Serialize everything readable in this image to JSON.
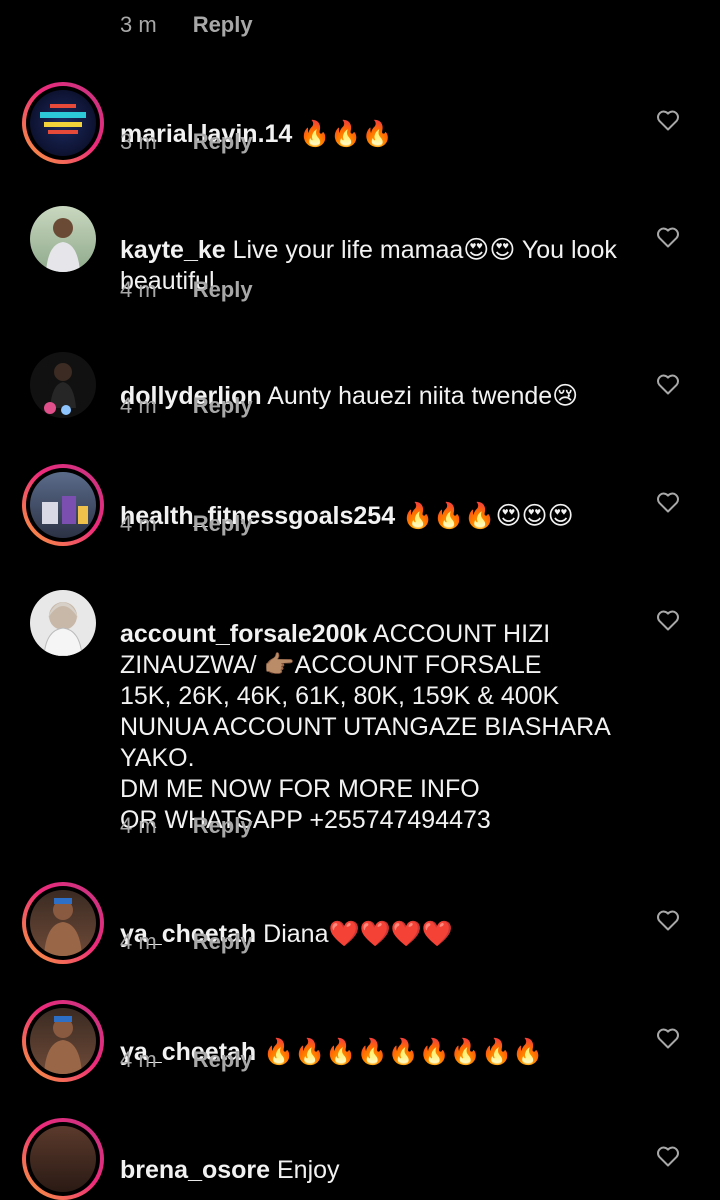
{
  "top": {
    "time": "3 m",
    "reply": "Reply"
  },
  "comments": [
    {
      "user": "marial.lavin.14",
      "text": " 🔥🔥🔥",
      "time": "3 m",
      "reply": "Reply"
    },
    {
      "user": "kayte_ke",
      "text": " Live your life mamaa😍😍 You look beautiful",
      "time": "4 m",
      "reply": "Reply"
    },
    {
      "user": "dollyderlion",
      "text": " Aunty hauezi niita twende😢",
      "time": "4 m",
      "reply": "Reply"
    },
    {
      "user": "health_fitnessgoals254",
      "text": " 🔥🔥🔥😍😍😍",
      "time": "4 m",
      "reply": "Reply"
    },
    {
      "user": "account_forsale200k",
      "text": " ACCOUNT HIZI ZINAUZWA/ 👉🏽ACCOUNT FORSALE\n15K, 26K, 46K, 61K, 80K, 159K & 400K\nNUNUA ACCOUNT  UTANGAZE BIASHARA YAKO.\nDM ME NOW FOR MORE INFO\nOR WHATSAPP +255747494473",
      "time": "4 m",
      "reply": "Reply"
    },
    {
      "user": "ya_cheetah",
      "text": " Diana❤️❤️❤️❤️",
      "time": "4 m",
      "reply": "Reply"
    },
    {
      "user": "ya_cheetah",
      "text": " 🔥🔥🔥🔥🔥🔥🔥🔥🔥",
      "time": "4 m",
      "reply": "Reply"
    },
    {
      "user": "brena_osore",
      "text": " Enjoy",
      "time": "",
      "reply": ""
    }
  ],
  "colors": {
    "background": "#000000",
    "text": "#f2f2f2",
    "muted": "#a8a8a8",
    "story_ring_start": "#f9a23a",
    "story_ring_end": "#c13584"
  },
  "icons": {
    "like": "heart-outline-icon"
  }
}
